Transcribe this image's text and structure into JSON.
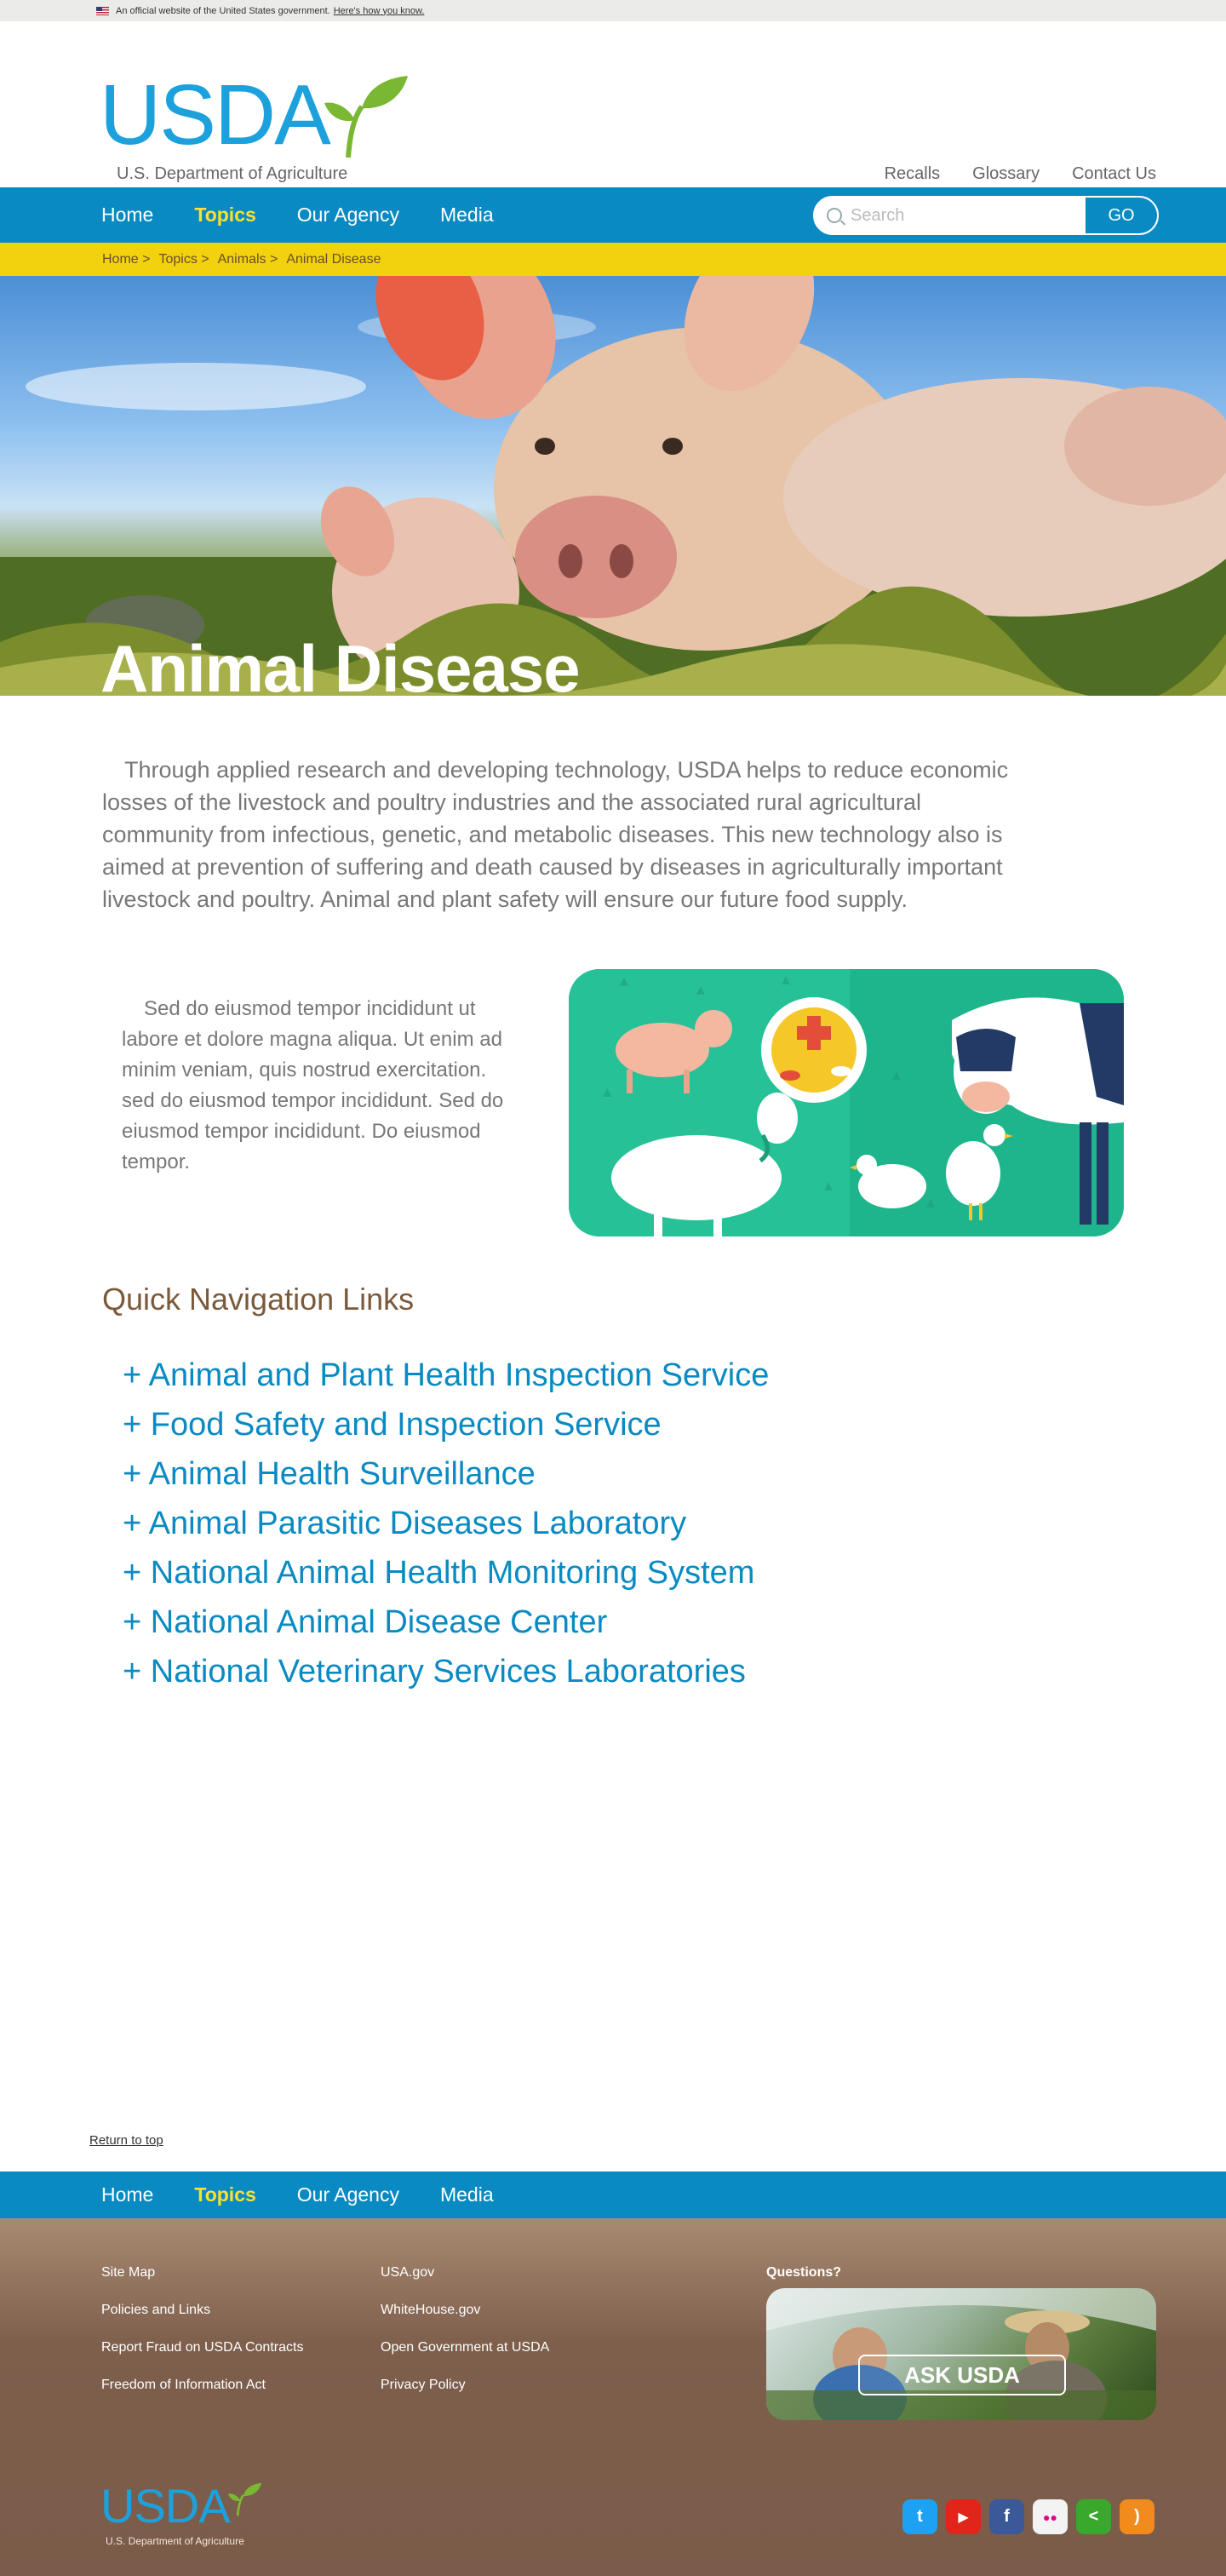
{
  "gov_banner": {
    "text": "An official website of the United States government.",
    "link": "Here's how you know."
  },
  "header": {
    "logo_text": "USDA",
    "logo_subtitle": "U.S. Department of Agriculture",
    "util_links": [
      "Recalls",
      "Glossary",
      "Contact Us"
    ]
  },
  "nav": {
    "items": [
      "Home",
      "Topics",
      "Our Agency",
      "Media"
    ],
    "active": "Topics",
    "search_placeholder": "Search",
    "go_label": "GO"
  },
  "breadcrumb": [
    "Home >",
    "Topics >",
    "Animals >",
    "Animal Disease"
  ],
  "hero": {
    "title": "Animal Disease"
  },
  "intro": "Through applied research and developing technology, USDA helps to reduce economic losses of the livestock and poultry industries and the associated rural agricultural community from infectious, genetic, and metabolic diseases. This new technology also is aimed at prevention of suffering and death caused by diseases in agriculturally important livestock and poultry. Animal and plant safety will ensure our future food supply.",
  "feature": {
    "text": "Sed do eiusmod tempor incididunt ut labore et dolore magna aliqua. Ut enim ad minim veniam, quis nostrud exercitation. sed do eiusmod tempor incididunt. Sed do eiusmod tempor incididunt. Do eiusmod tempor."
  },
  "quick_nav": {
    "heading": "Quick Navigation Links",
    "links": [
      "+ Animal and Plant Health Inspection Service",
      "+ Food Safety and Inspection Service",
      "+ Animal Health Surveillance",
      "+ Animal Parasitic Diseases Laboratory",
      "+ National Animal Health Monitoring System",
      "+ National Animal Disease Center",
      "+ National Veterinary Services Laboratories"
    ]
  },
  "return_to_top": "Return to top",
  "footer": {
    "col1": [
      "Site Map",
      "Policies and Links",
      "Report Fraud on USDA Contracts",
      "Freedom of Information Act"
    ],
    "col2": [
      "USA.gov",
      "WhiteHouse.gov",
      "Open Government at USDA",
      "Privacy Policy"
    ],
    "questions_label": "Questions?",
    "ask_label": "ASK USDA",
    "logo_text": "USDA",
    "logo_subtitle": "U.S. Department of Agriculture",
    "social": [
      {
        "icon": "twitter-icon",
        "glyph": "t",
        "color": "#1da1f2"
      },
      {
        "icon": "youtube-icon",
        "glyph": "▶",
        "color": "#e0261b"
      },
      {
        "icon": "facebook-icon",
        "glyph": "f",
        "color": "#3b5998"
      },
      {
        "icon": "flickr-icon",
        "glyph": "●●",
        "color": "#f3f3f3"
      },
      {
        "icon": "share-icon",
        "glyph": "<",
        "color": "#3aa82c"
      },
      {
        "icon": "rss-icon",
        "glyph": ")",
        "color": "#f28b1e"
      }
    ]
  },
  "colors": {
    "brand_blue": "#0a8ac2",
    "accent_yellow": "#f2d20c",
    "brown": "#7b5a3b"
  }
}
